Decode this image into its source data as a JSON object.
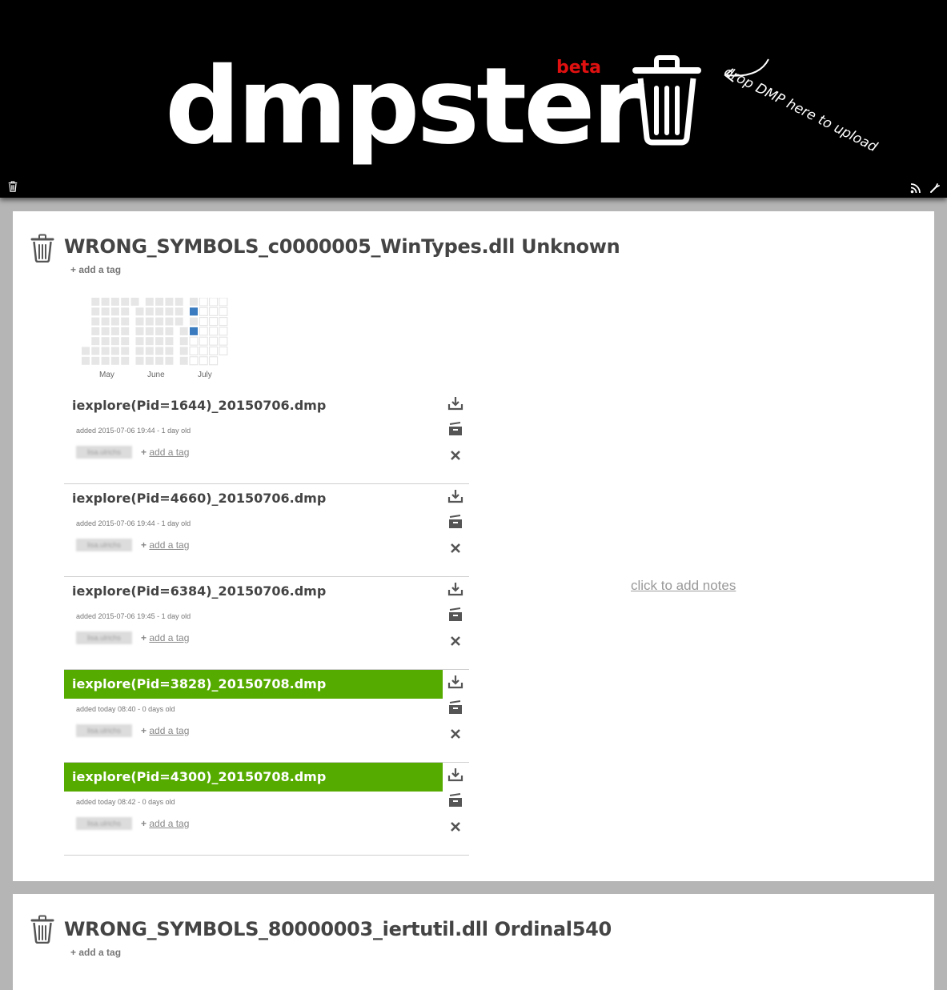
{
  "header": {
    "logo": "dmpster",
    "beta": "beta",
    "drop_hint": "drop DMP here to upload"
  },
  "buckets": [
    {
      "title": "WRONG_SYMBOLS_c0000005_WinTypes.dll Unknown",
      "add_tag": "+ add a tag",
      "heatmap": {
        "months": [
          "May",
          "June",
          "July"
        ],
        "highlighted_days": [
          "2015-07-06",
          "2015-07-08"
        ],
        "highlight_color": "#3a7bbf"
      },
      "notes": "click to add notes",
      "dumps": [
        {
          "name": "iexplore(Pid=1644)_20150706.dmp",
          "added": "added 2015-07-06 19:44 - 1 day old",
          "user": "lisa.ulrichs",
          "tag_plus": "+",
          "tag_link": "add a tag",
          "new": false
        },
        {
          "name": "iexplore(Pid=4660)_20150706.dmp",
          "added": "added 2015-07-06 19:44 - 1 day old",
          "user": "lisa.ulrichs",
          "tag_plus": "+",
          "tag_link": "add a tag",
          "new": false
        },
        {
          "name": "iexplore(Pid=6384)_20150706.dmp",
          "added": "added 2015-07-06 19:45 - 1 day old",
          "user": "lisa.ulrichs",
          "tag_plus": "+",
          "tag_link": "add a tag",
          "new": false
        },
        {
          "name": "iexplore(Pid=3828)_20150708.dmp",
          "added": "added today 08:40 - 0 days old",
          "user": "lisa.ulrichs",
          "tag_plus": "+",
          "tag_link": "add a tag",
          "new": true
        },
        {
          "name": "iexplore(Pid=4300)_20150708.dmp",
          "added": "added today 08:42 - 0 days old",
          "user": "lisa.ulrichs",
          "tag_plus": "+",
          "tag_link": "add a tag",
          "new": true
        }
      ]
    },
    {
      "title": "WRONG_SYMBOLS_80000003_iertutil.dll Ordinal540",
      "add_tag": "+ add a tag"
    }
  ],
  "icons": {
    "header_left": "trash-icon",
    "header_right": [
      "rss-icon",
      "wrench-icon"
    ],
    "dump_actions": [
      "download-icon",
      "archive-icon",
      "delete-icon"
    ]
  },
  "colors": {
    "new_dump": "#56ab00",
    "header_bg": "#000000",
    "page_bg": "#b5b5b5"
  }
}
